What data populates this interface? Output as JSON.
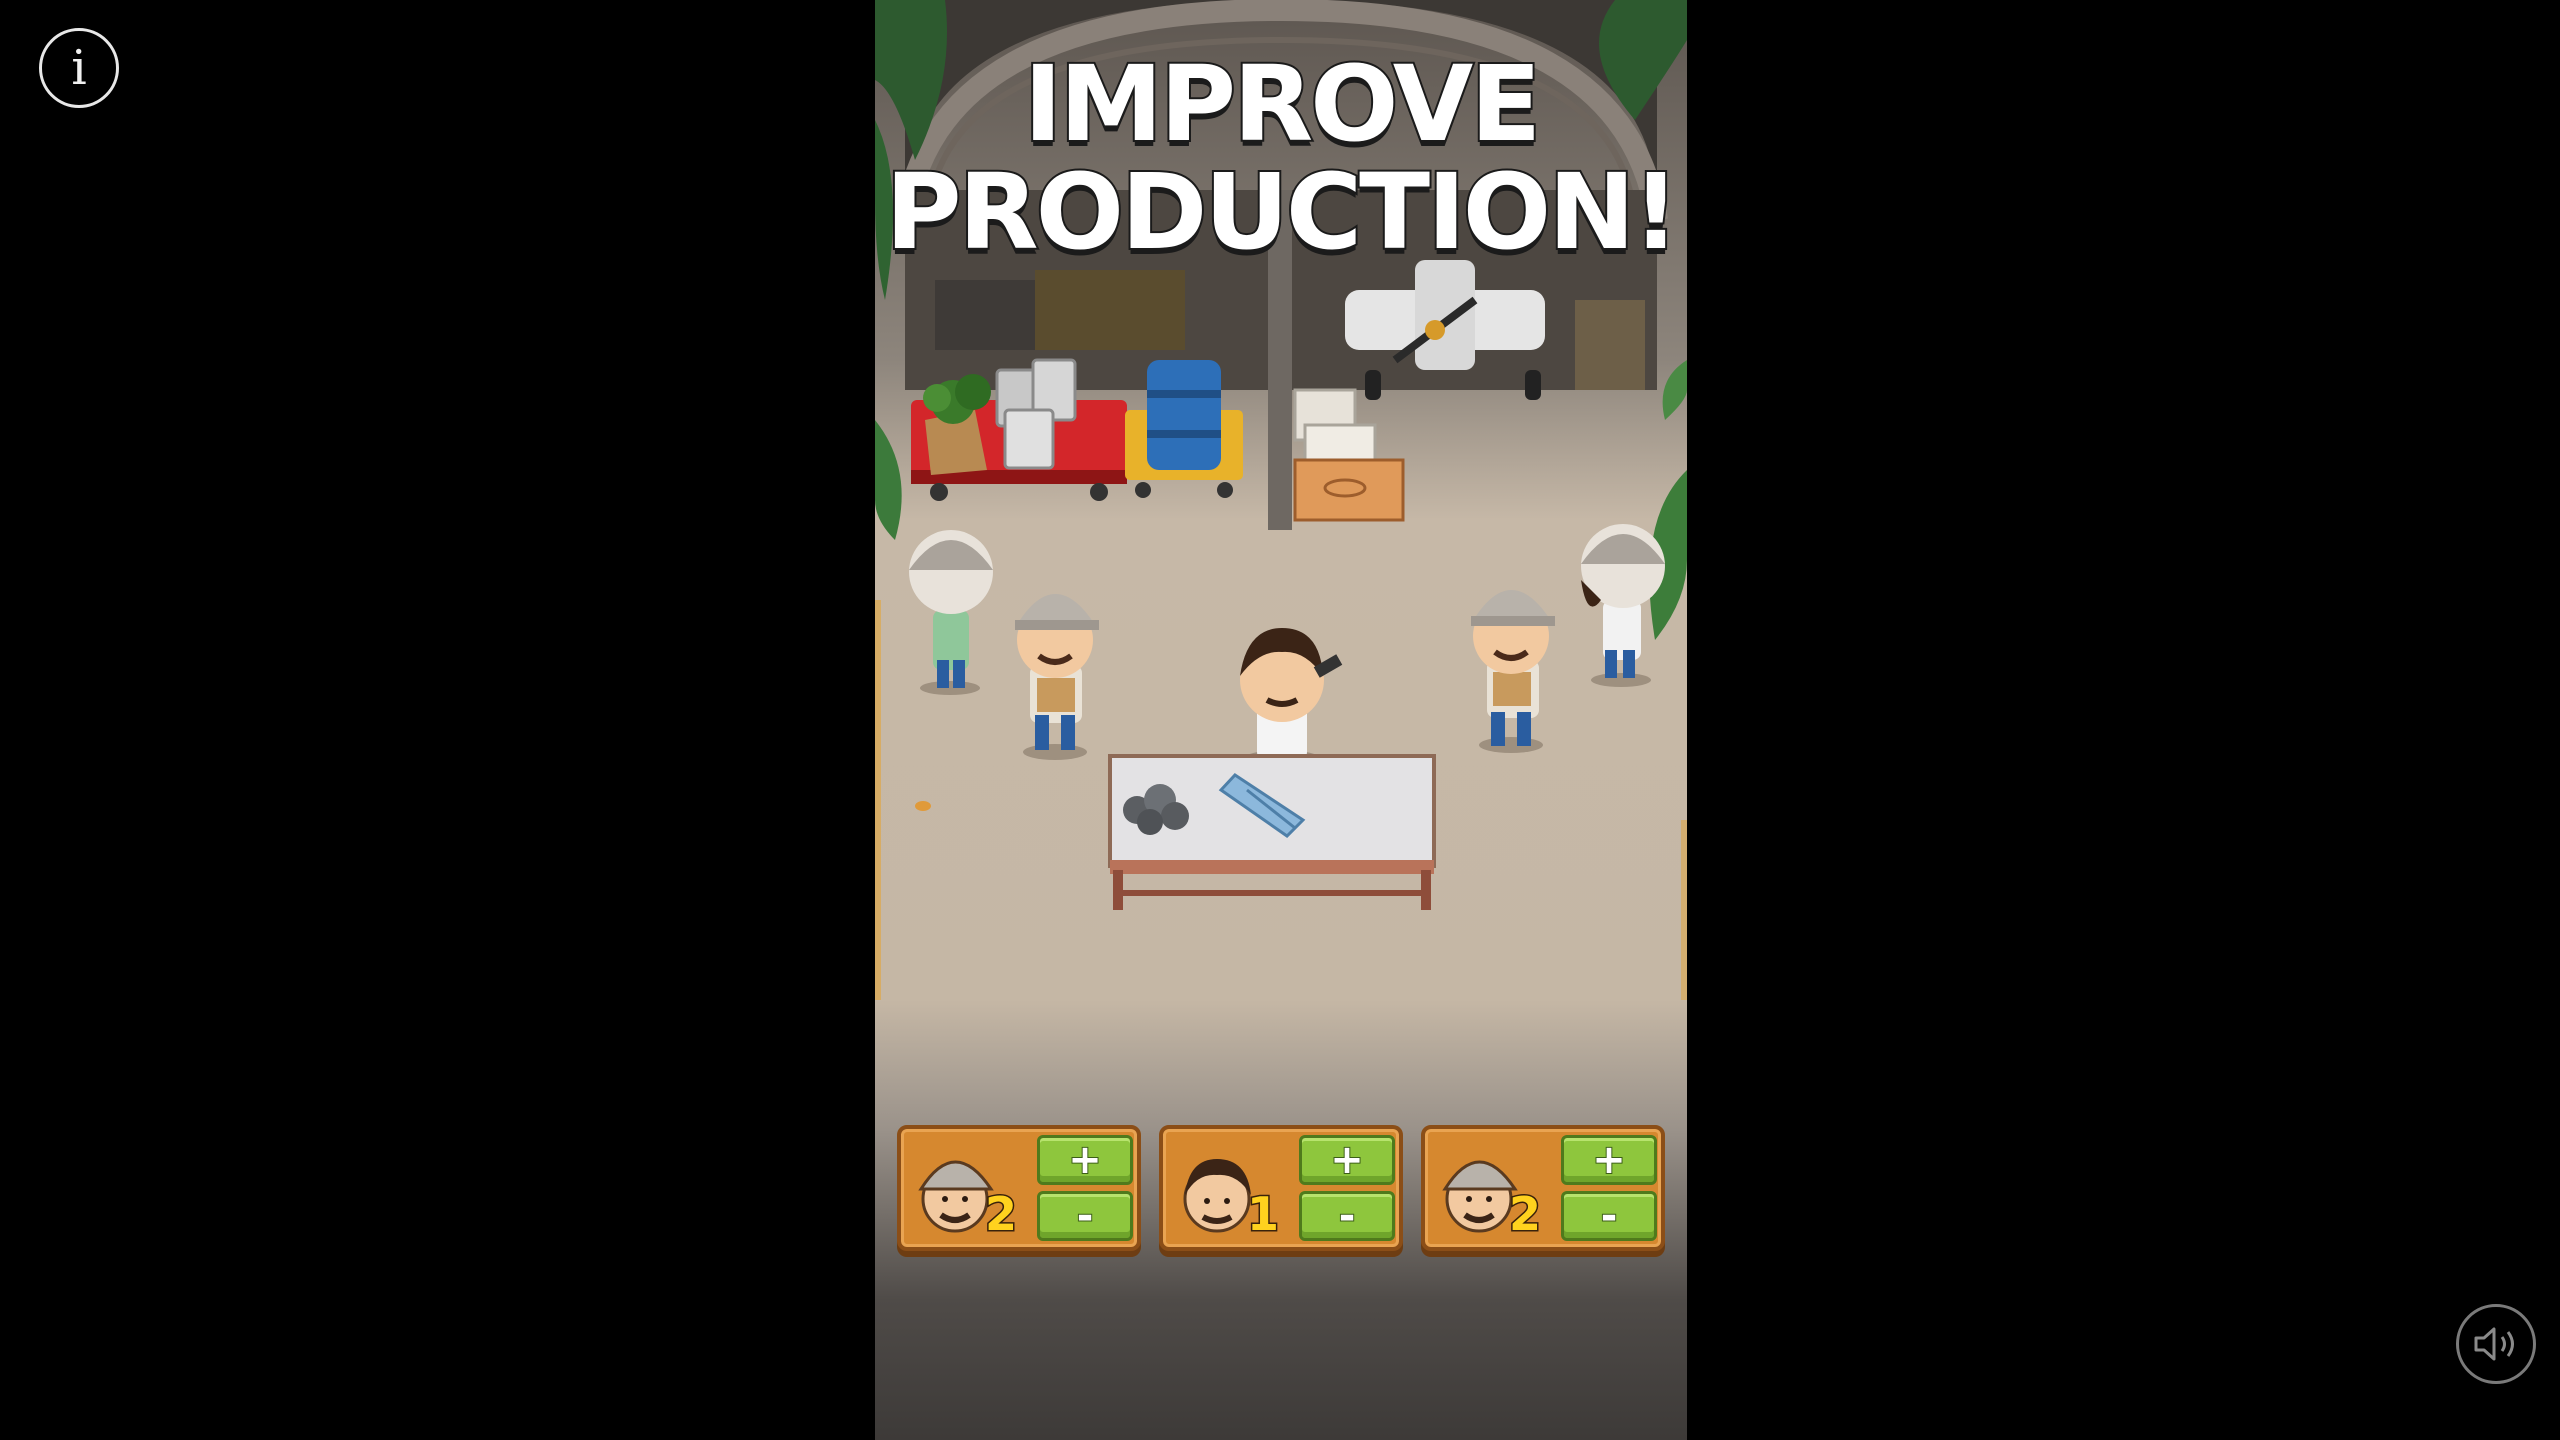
{
  "hud": {
    "info_label": "i",
    "sound_icon": "speaker-icon"
  },
  "game": {
    "headline_line1": "IMPROVE",
    "headline_line2": "PRODUCTION!",
    "worker_slots": [
      {
        "kind": "porter",
        "count": "2",
        "plus_label": "+",
        "minus_label": "-"
      },
      {
        "kind": "boss",
        "count": "1",
        "plus_label": "+",
        "minus_label": "-"
      },
      {
        "kind": "porter",
        "count": "2",
        "plus_label": "+",
        "minus_label": "-"
      }
    ]
  },
  "colors": {
    "button_green": "#8ec63d",
    "panel_orange": "#d6882f",
    "count_yellow": "#ffd21e"
  }
}
